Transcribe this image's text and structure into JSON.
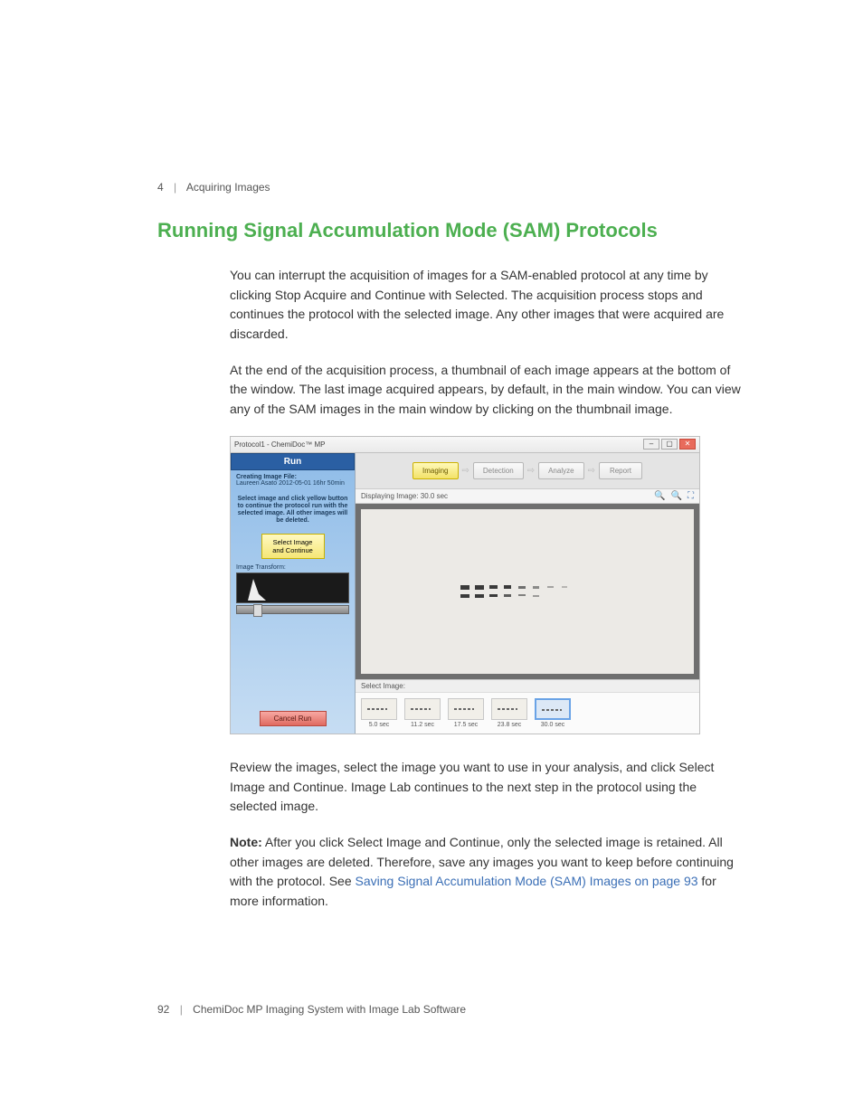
{
  "header": {
    "chapter_num": "4",
    "chapter_title": "Acquiring Images"
  },
  "section_title": "Running Signal Accumulation Mode (SAM) Protocols",
  "paragraphs": {
    "p1": "You can interrupt the acquisition of images for a SAM-enabled protocol at any time by clicking Stop Acquire and Continue with Selected. The acquisition process stops and continues the protocol with the selected image. Any other images that were acquired are discarded.",
    "p2": "At the end of the acquisition process, a thumbnail of each image appears at the bottom of the window. The last image acquired appears, by default, in the main window. You can view any of the SAM images in the main window by clicking on the thumbnail image.",
    "p3": "Review the images, select the image you want to use in your analysis, and click Select Image and Continue. Image Lab continues to the next step in the protocol using the selected image.",
    "note_label": "Note:",
    "note_body_pre": "  After you click Select Image and Continue, only the selected image is retained. All other images are deleted. Therefore, save any images you want to keep before continuing with the protocol. See ",
    "note_link": "Saving Signal Accumulation Mode (SAM) Images on page 93",
    "note_body_post": " for more information."
  },
  "footer": {
    "page_num": "92",
    "doc_title": "ChemiDoc MP Imaging System with Image Lab Software"
  },
  "screenshot": {
    "window_title": "Protocol1 - ChemiDoc™ MP",
    "left": {
      "run_label": "Run",
      "creating_label": "Creating Image File:",
      "creating_value": "Laureen Asato 2012-05-01 16hr 50min",
      "instruction": "Select image and click yellow button to continue the protocol run with the selected image. All other images will be deleted.",
      "select_btn": "Select Image and Continue",
      "transform_label": "Image Transform:",
      "cancel_btn": "Cancel Run"
    },
    "steps": {
      "imaging": "Imaging",
      "detection": "Detection",
      "analyze": "Analyze",
      "report": "Report"
    },
    "display_label": "Displaying Image: 30.0 sec",
    "select_label": "Select Image:",
    "thumbs": [
      {
        "label": "5.0 sec"
      },
      {
        "label": "11.2 sec"
      },
      {
        "label": "17.5 sec"
      },
      {
        "label": "23.8 sec"
      },
      {
        "label": "30.0 sec"
      }
    ]
  }
}
